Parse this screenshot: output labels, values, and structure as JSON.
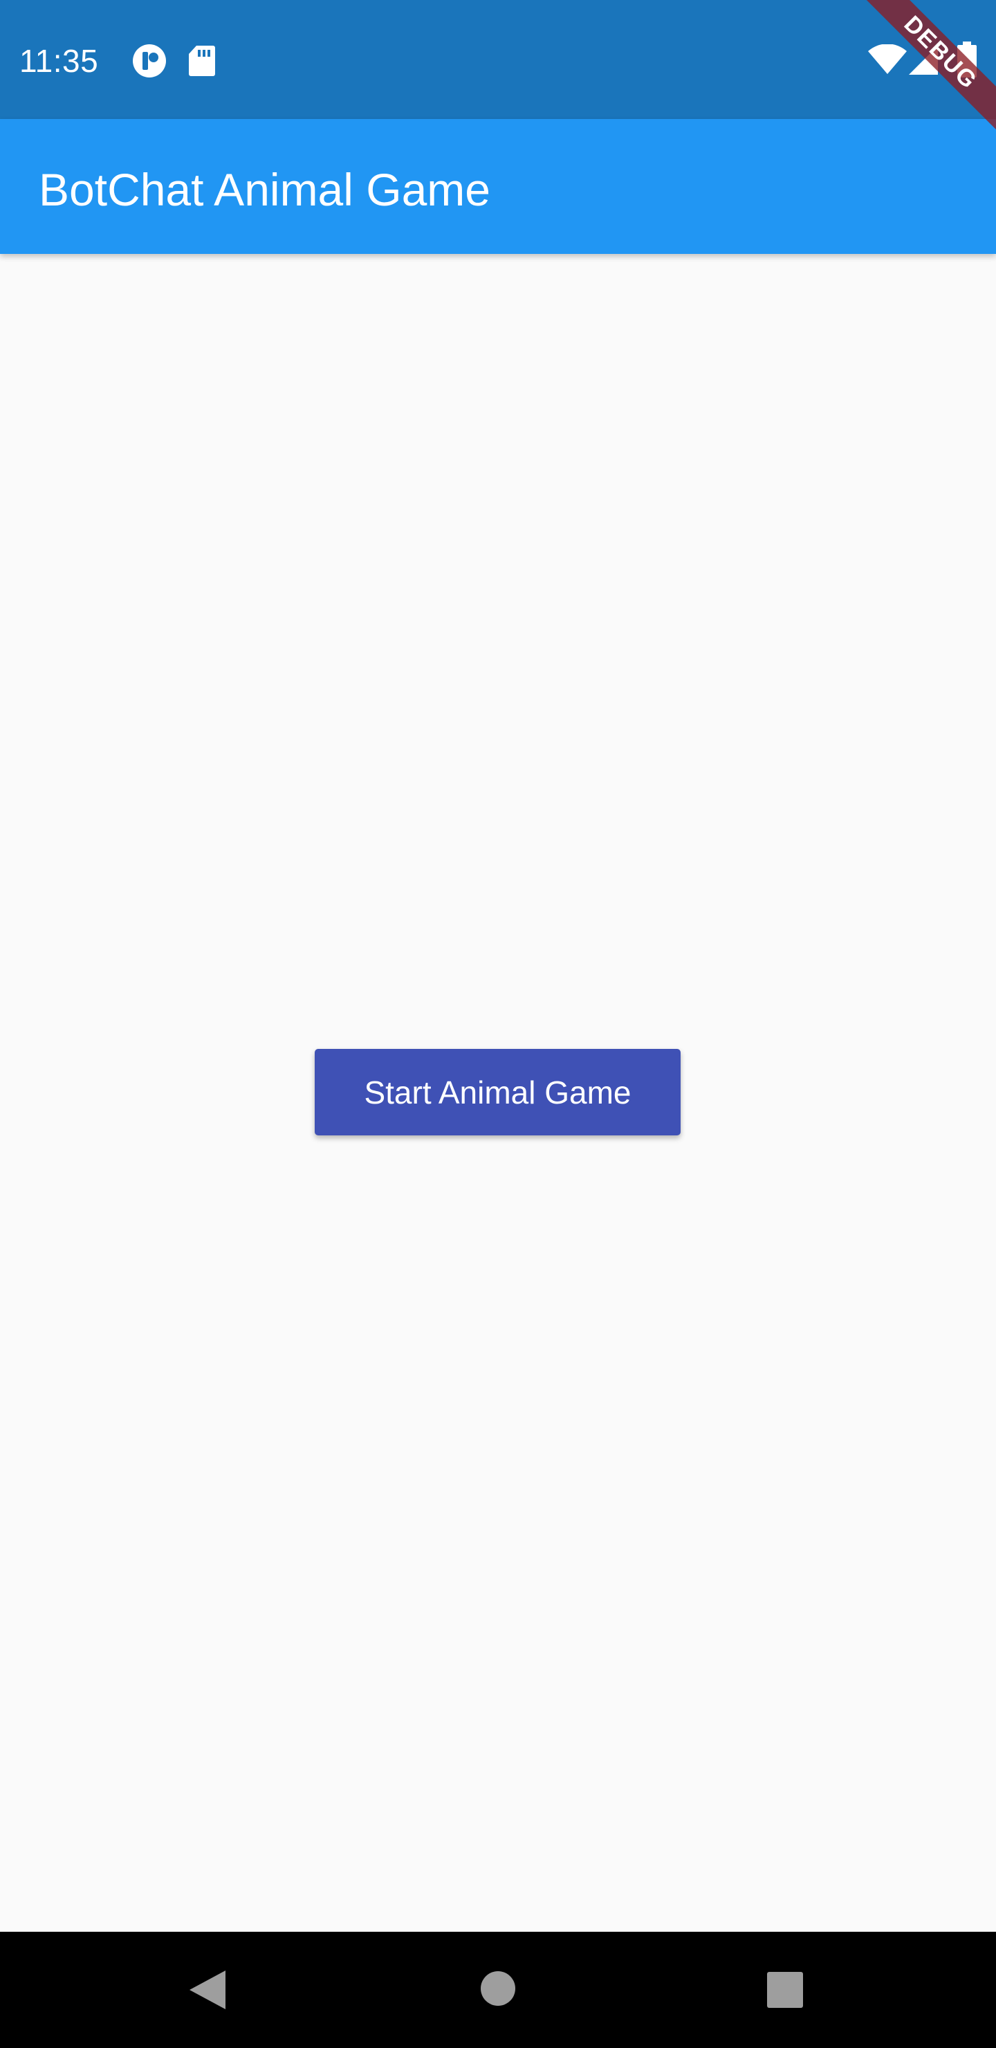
{
  "status_bar": {
    "time": "11:35",
    "left_icons": [
      "notification-app-icon",
      "sd-card-icon"
    ],
    "right_icons": [
      "wifi-icon",
      "cell-signal-icon",
      "battery-icon"
    ],
    "background_color": "#1a75bb"
  },
  "debug_banner": {
    "label": "DEBUG"
  },
  "app_bar": {
    "title": "BotChat Animal Game",
    "background_color": "#2196f3"
  },
  "main": {
    "start_button_label": "Start Animal Game",
    "button_color": "#3f51b5",
    "background_color": "#fafafa"
  },
  "nav_bar": {
    "buttons": [
      "back-icon",
      "home-icon",
      "recents-icon"
    ]
  }
}
